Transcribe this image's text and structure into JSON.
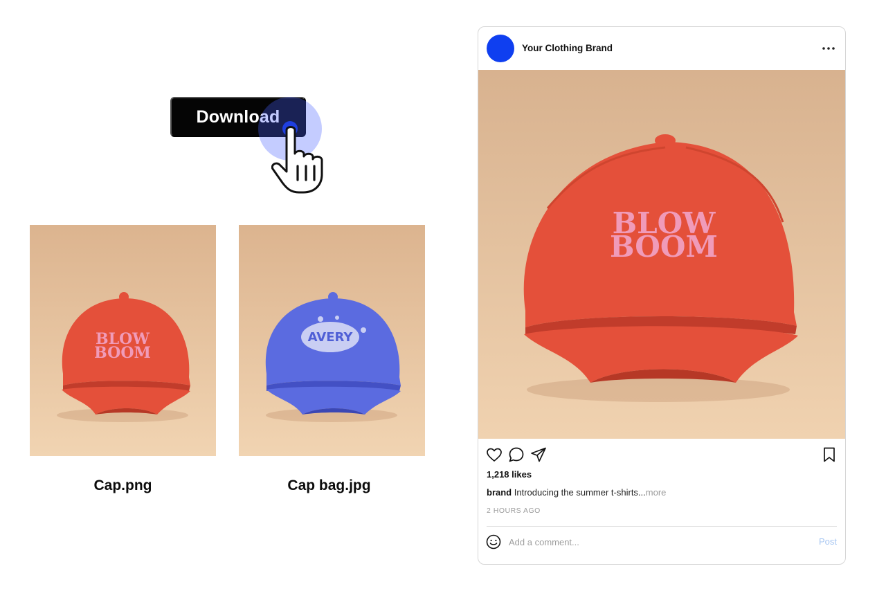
{
  "download": {
    "label": "Download"
  },
  "files": [
    {
      "label": "Cap.png",
      "cap_color": "#e4503a",
      "logo": "BLOW BOOM"
    },
    {
      "label": "Cap bag.jpg",
      "cap_color": "#5b6be0",
      "logo": "AVERY"
    }
  ],
  "post": {
    "brand_name": "Your Clothing Brand",
    "avatar_color": "#0f3ff0",
    "image_logo": "BLOW BOOM",
    "likes": "1,218 likes",
    "caption_user": "brand",
    "caption_text": "Introducing the summer t-shirts...",
    "caption_more": "more",
    "time": "2 HOURS AGO",
    "comment_placeholder": "Add a comment...",
    "post_label": "Post"
  },
  "icons": {
    "more": "more-horizontal-icon",
    "like": "heart-icon",
    "comment": "comment-icon",
    "share": "send-icon",
    "save": "bookmark-icon",
    "emoji": "smiley-icon",
    "cursor": "hand-pointer-icon"
  }
}
